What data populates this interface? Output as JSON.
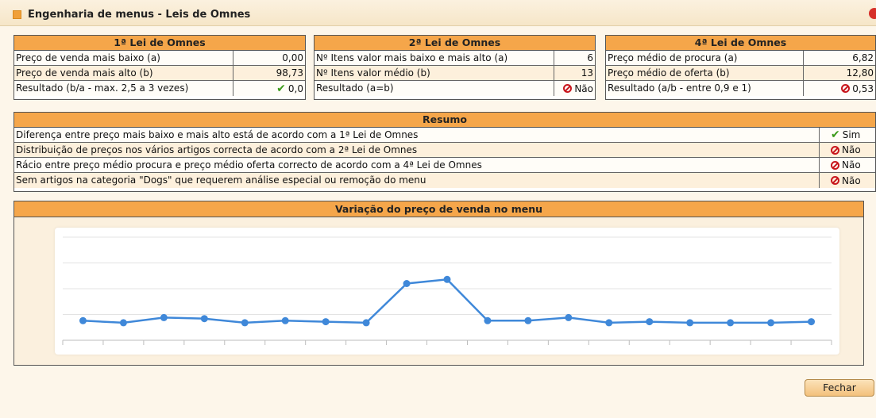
{
  "window": {
    "title": "Engenharia de menus - Leis de Omnes"
  },
  "law1": {
    "title": "1ª Lei de Omnes",
    "rows": [
      {
        "label": "Preço de venda mais baixo (a)",
        "value": "0,00"
      },
      {
        "label": "Preço de venda mais alto (b)",
        "value": "98,73"
      },
      {
        "label": "Resultado (b/a - max. 2,5 a 3 vezes)",
        "value": "0,0",
        "status": "check-icon"
      }
    ]
  },
  "law2": {
    "title": "2ª Lei de Omnes",
    "rows": [
      {
        "label": "Nº Itens valor mais baixo e mais alto (a)",
        "value": "6"
      },
      {
        "label": "Nº Itens valor médio (b)",
        "value": "13"
      },
      {
        "label": "Resultado (a=b)",
        "value": "Não",
        "status": "prohibited-icon"
      }
    ]
  },
  "law4": {
    "title": "4ª Lei de Omnes",
    "rows": [
      {
        "label": "Preço médio de procura (a)",
        "value": "6,82"
      },
      {
        "label": "Preço médio de oferta (b)",
        "value": "12,80"
      },
      {
        "label": "Resultado (a/b - entre 0,9 e 1)",
        "value": "0,53",
        "status": "prohibited-icon"
      }
    ]
  },
  "summary": {
    "title": "Resumo",
    "rows": [
      {
        "label": "Diferença entre preço mais baixo e mais alto está de acordo com a 1ª Lei de Omnes",
        "value": "Sim",
        "status": "check-icon"
      },
      {
        "label": "Distribuição de preços nos vários artigos correcta de acordo com a 2ª Lei de Omnes",
        "value": "Não",
        "status": "prohibited-icon"
      },
      {
        "label": "Rácio entre preço médio procura e preço médio oferta correcto de acordo com a 4ª Lei de Omnes",
        "value": "Não",
        "status": "prohibited-icon"
      },
      {
        "label": "Sem artigos na categoria \"Dogs\" que requerem análise especial ou remoção do menu",
        "value": "Não",
        "status": "prohibited-icon"
      }
    ]
  },
  "chart": {
    "title": "Variação do preço de venda no menu"
  },
  "chart_data": {
    "type": "line",
    "title": "Variação do preço de venda no menu",
    "xlabel": "",
    "ylabel": "",
    "ylim": [
      0,
      100
    ],
    "grid": true,
    "x": [
      1,
      2,
      3,
      4,
      5,
      6,
      7,
      8,
      9,
      10,
      11,
      12,
      13,
      14,
      15,
      16,
      17,
      18,
      19
    ],
    "series": [
      {
        "values": [
          19,
          17,
          22,
          21,
          17,
          19,
          18,
          17,
          55,
          59,
          19,
          19,
          22,
          17,
          18,
          17,
          17,
          17,
          18
        ],
        "color": "#3f88d9"
      }
    ]
  },
  "buttons": {
    "close": "Fechar"
  },
  "colors": {
    "header": "#f5a64a",
    "accent": "#3f88d9",
    "ok": "#3a9a1a",
    "error": "#c8161d"
  }
}
